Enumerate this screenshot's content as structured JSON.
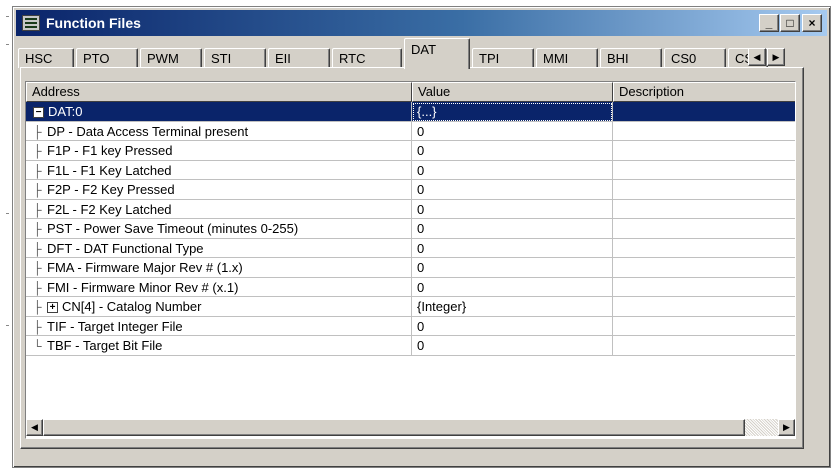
{
  "window": {
    "title": "Function Files"
  },
  "titlebar_buttons": [
    {
      "name": "minimize-button",
      "glyph": "_"
    },
    {
      "name": "maximize-button",
      "glyph": "□"
    },
    {
      "name": "close-button",
      "glyph": "×"
    }
  ],
  "tabs": [
    {
      "label": "HSC",
      "active": false
    },
    {
      "label": "PTO",
      "active": false
    },
    {
      "label": "PWM",
      "active": false
    },
    {
      "label": "STI",
      "active": false
    },
    {
      "label": "EII",
      "active": false
    },
    {
      "label": "RTC",
      "active": false
    },
    {
      "label": "DAT",
      "active": true
    },
    {
      "label": "TPI",
      "active": false
    },
    {
      "label": "MMI",
      "active": false
    },
    {
      "label": "BHI",
      "active": false
    },
    {
      "label": "CS0",
      "active": false
    },
    {
      "label": "CS",
      "active": false
    }
  ],
  "tab_scroll": {
    "left_glyph": "◀",
    "right_glyph": "▶"
  },
  "grid": {
    "columns": [
      "Address",
      "Value",
      "Description"
    ],
    "rows": [
      {
        "address": "DAT:0",
        "value": "{...}",
        "description": "",
        "expander": "−",
        "selected": true,
        "level": 0
      },
      {
        "address": "DP - Data Access Terminal present",
        "value": "0",
        "description": "",
        "level": 1
      },
      {
        "address": "F1P - F1 key Pressed",
        "value": "0",
        "description": "",
        "level": 1
      },
      {
        "address": "F1L - F1 Key Latched",
        "value": "0",
        "description": "",
        "level": 1
      },
      {
        "address": "F2P - F2 Key Pressed",
        "value": "0",
        "description": "",
        "level": 1
      },
      {
        "address": "F2L - F2 Key Latched",
        "value": "0",
        "description": "",
        "level": 1
      },
      {
        "address": "PST - Power Save Timeout (minutes 0-255)",
        "value": "0",
        "description": "",
        "level": 1
      },
      {
        "address": "DFT - DAT Functional Type",
        "value": "0",
        "description": "",
        "level": 1
      },
      {
        "address": "FMA - Firmware Major Rev # (1.x)",
        "value": "0",
        "description": "",
        "level": 1
      },
      {
        "address": "FMI - Firmware Minor Rev # (x.1)",
        "value": "0",
        "description": "",
        "level": 1
      },
      {
        "address": "CN[4] - Catalog Number",
        "value": "{Integer}",
        "description": "",
        "expander": "+",
        "level": 1
      },
      {
        "address": "TIF - Target Integer File",
        "value": "0",
        "description": "",
        "level": 1
      },
      {
        "address": "TBF - Target Bit File",
        "value": "0",
        "description": "",
        "level": 1,
        "last": true
      }
    ]
  },
  "hscroll": {
    "left_glyph": "◀",
    "right_glyph": "▶"
  },
  "colors": {
    "title_start": "#0a246a",
    "title_end": "#a6caf0",
    "selection": "#0a246a",
    "face": "#d4d0c8"
  }
}
